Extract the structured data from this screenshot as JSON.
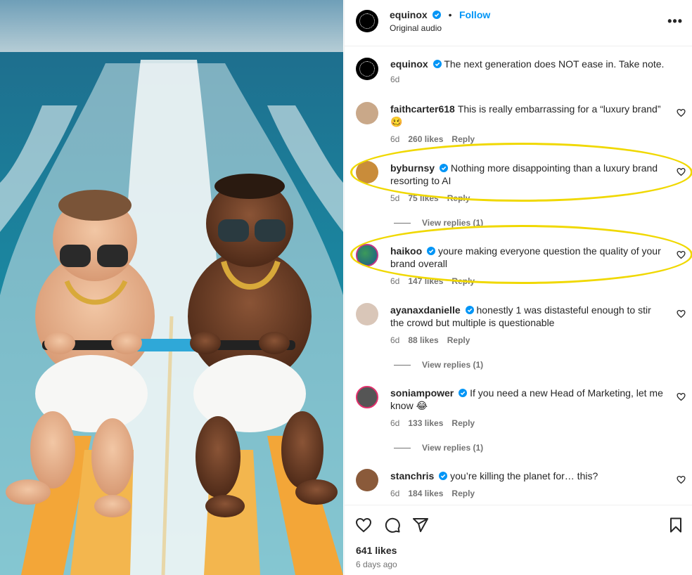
{
  "post": {
    "author": "equinox",
    "follow_label": "Follow",
    "audio": "Original audio",
    "separator": "•",
    "more_label": "•••",
    "caption": "The next generation does NOT ease in. Take note.",
    "caption_age": "6d"
  },
  "comments": [
    {
      "user": "faithcarter618",
      "verified": false,
      "text": "This is really embarrassing for a “luxury brand” 🥴",
      "age": "6d",
      "likes": "260 likes",
      "reply": "Reply"
    },
    {
      "user": "byburnsy",
      "verified": true,
      "text": "Nothing more disappointing than a luxury brand resorting to AI",
      "age": "5d",
      "likes": "75 likes",
      "reply": "Reply",
      "view_replies": "View replies (1)"
    },
    {
      "user": "haikoo",
      "verified": true,
      "text": "youre making everyone question the quality of your brand overall",
      "age": "6d",
      "likes": "147 likes",
      "reply": "Reply"
    },
    {
      "user": "ayanaxdanielle",
      "verified": true,
      "text": "honestly 1 was distasteful enough to stir the crowd but multiple is questionable",
      "age": "6d",
      "likes": "88 likes",
      "reply": "Reply",
      "view_replies": "View replies (1)"
    },
    {
      "user": "soniampower",
      "verified": true,
      "text": "If you need a new Head of Marketing, let me know 😂",
      "age": "6d",
      "likes": "133 likes",
      "reply": "Reply",
      "view_replies": "View replies (1)"
    },
    {
      "user": "stanchris",
      "verified": true,
      "text": "you’re killing the planet for… this?",
      "age": "6d",
      "likes": "184 likes",
      "reply": "Reply"
    }
  ],
  "footer": {
    "likes": "641 likes",
    "time": "6 days ago"
  },
  "icons": [
    "verified-badge-icon",
    "heart-icon",
    "comment-icon",
    "share-icon",
    "bookmark-icon",
    "more-icon"
  ],
  "colors": {
    "link_blue": "#0095f6",
    "verified_blue": "#0095f6",
    "highlight_yellow": "#f0d800",
    "muted": "#737373"
  }
}
